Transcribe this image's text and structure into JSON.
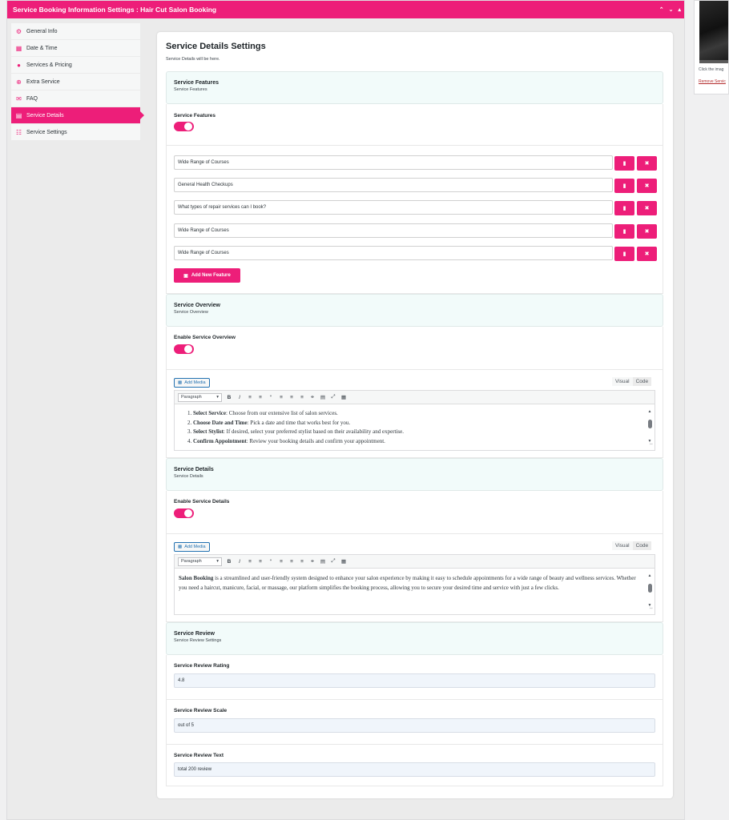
{
  "metabox": {
    "title": "Service Booking Information Settings : Hair Cut Salon Booking",
    "controls": [
      "^",
      "v",
      "^"
    ]
  },
  "sidebar": {
    "items": [
      {
        "label": "General Info",
        "icon": "gear-icon"
      },
      {
        "label": "Date & Time",
        "icon": "calendar-icon"
      },
      {
        "label": "Services & Pricing",
        "icon": "coins-icon"
      },
      {
        "label": "Extra Service",
        "icon": "plus-circle-icon"
      },
      {
        "label": "FAQ",
        "icon": "chat-icon"
      },
      {
        "label": "Service Details",
        "icon": "table-icon",
        "active": true
      },
      {
        "label": "Service Settings",
        "icon": "network-icon"
      }
    ]
  },
  "main": {
    "title": "Service Details Settings",
    "description": "Service Details will be here."
  },
  "features": {
    "section_title": "Service Features",
    "section_subtitle": "Service Features",
    "toggle_label": "Service Features",
    "toggle_on": true,
    "items": [
      "Wide Range of Courses",
      "General Health Checkups",
      "What types of repair services can I book?",
      "Wide Range of Courses",
      "Wide Range of Courses"
    ],
    "add_label": "Add New Feature"
  },
  "overview": {
    "section_title": "Service Overview",
    "section_subtitle": "Service Overview",
    "toggle_label": "Enable Service Overview",
    "toggle_on": true,
    "add_media": "Add Media",
    "visual_tab": "Visual",
    "code_tab": "Code",
    "format": "Paragraph",
    "list": [
      {
        "bold": "Select Service",
        "text": ": Choose from our extensive list of salon services."
      },
      {
        "bold": "Choose Date and Time",
        "text": ": Pick a date and time that works best for you."
      },
      {
        "bold": "Select Stylist",
        "text": ": If desired, select your preferred stylist based on their availability and expertise."
      },
      {
        "bold": "Confirm Appointment",
        "text": ": Review your booking details and confirm your appointment."
      }
    ]
  },
  "details": {
    "section_title": "Service Details",
    "section_subtitle": "Service Details",
    "toggle_label": "Enable Service Details",
    "toggle_on": true,
    "add_media": "Add Media",
    "visual_tab": "Visual",
    "code_tab": "Code",
    "format": "Paragraph",
    "content_bold": "Salon Booking",
    "content_text": " is a streamlined and user-friendly system designed to enhance your salon experience by making it easy to schedule appointments for a wide range of beauty and wellness services. Whether you need a haircut, manicure, facial, or massage, our platform simplifies the booking process, allowing you to secure your desired time and service with just a few clicks."
  },
  "review": {
    "section_title": "Service Review",
    "section_subtitle": "Service Review Settings",
    "rating_label": "Service Review Rating",
    "rating_value": "4.8",
    "scale_label": "Service Review Scale",
    "scale_value": "out of 5",
    "text_label": "Service Review Text",
    "text_value": "total 200 review"
  },
  "right_panel": {
    "caption": "Click the imag",
    "remove_link": "Remove Servic"
  },
  "colors": {
    "accent": "#ed1e79",
    "section_bg": "#f2fbfa"
  }
}
